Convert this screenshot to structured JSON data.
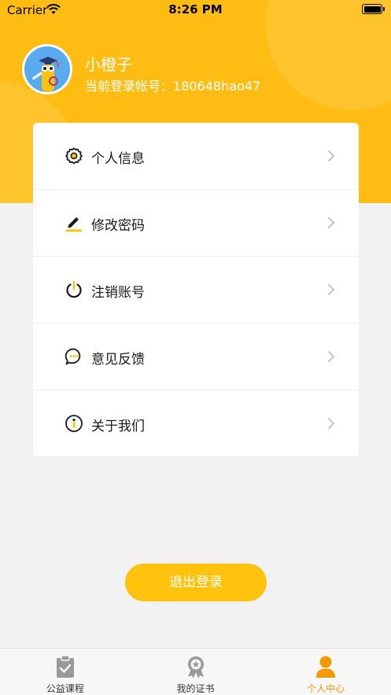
{
  "status_bar": {
    "carrier": "Carrier",
    "time": "8:26 PM"
  },
  "profile": {
    "name": "小橙子",
    "account_label": "当前登录帐号：",
    "account_id": "180648hao47"
  },
  "menu": {
    "items": [
      {
        "label": "个人信息",
        "icon": "gear-icon"
      },
      {
        "label": "修改密码",
        "icon": "pencil-icon"
      },
      {
        "label": "注销账号",
        "icon": "power-icon"
      },
      {
        "label": "意见反馈",
        "icon": "chat-bubble-icon"
      },
      {
        "label": "关于我们",
        "icon": "info-icon"
      }
    ]
  },
  "logout": {
    "label": "退出登录"
  },
  "tabs": [
    {
      "label": "公益课程",
      "icon": "clipboard-check-icon",
      "active": false
    },
    {
      "label": "我的证书",
      "icon": "award-medal-icon",
      "active": false
    },
    {
      "label": "个人中心",
      "icon": "user-icon",
      "active": true
    }
  ],
  "colors": {
    "accent": "#ffbd14",
    "button": "#ffc20d",
    "tab_active": "#f29a00",
    "background": "#f2f2f2"
  }
}
